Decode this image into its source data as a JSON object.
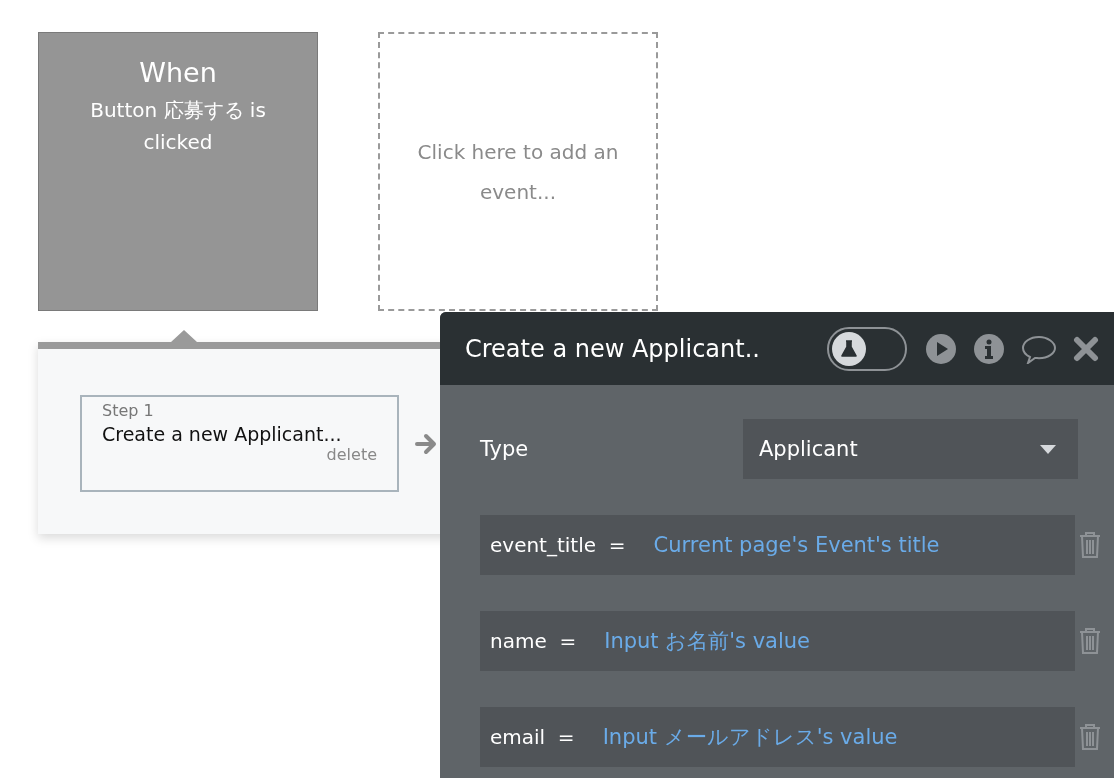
{
  "events": [
    {
      "kind": "event",
      "title": "When",
      "description": "Button 応募する is clicked"
    },
    {
      "kind": "placeholder",
      "description": "Click here to add an event..."
    }
  ],
  "steps": [
    {
      "label": "Step 1",
      "title": "Create a new Applicant...",
      "delete": "delete",
      "selected": true
    }
  ],
  "panel": {
    "title": "Create a new Applicant..",
    "test_mode": {
      "on": false
    },
    "type": {
      "label": "Type",
      "value": "Applicant"
    },
    "fields": [
      {
        "key": "event_title",
        "operator": "=",
        "value": "Current page's Event's title"
      },
      {
        "key": "name",
        "operator": "=",
        "value": "Input お名前's value"
      },
      {
        "key": "email",
        "operator": "=",
        "value": "Input メールアドレス's value"
      }
    ]
  }
}
